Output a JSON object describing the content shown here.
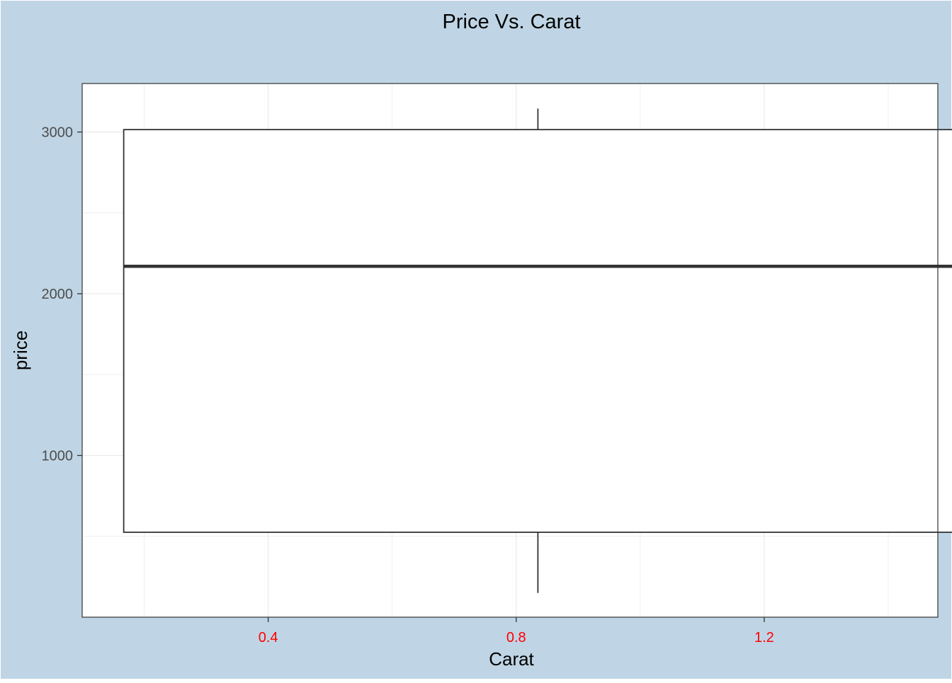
{
  "chart_data": {
    "type": "boxplot",
    "title": "Price Vs. Carat",
    "xlabel": "Carat",
    "ylabel": "price",
    "xlim": [
      0.1,
      1.48
    ],
    "ylim": [
      0,
      3300
    ],
    "x_ticks": [
      0.4,
      0.8,
      1.2
    ],
    "y_ticks": [
      1000,
      2000,
      3000
    ],
    "grid": true,
    "box": {
      "x_min": 0.167,
      "x_max": 1.505,
      "x_center": 0.835,
      "whisker_low": 150,
      "q1": 525,
      "median": 2170,
      "q3": 3015,
      "whisker_high": 3145
    },
    "colors": {
      "background": "#bfd5e5",
      "panel": "#ffffff",
      "x_tick_label": "#ff0000",
      "y_tick_label": "#4d4d4d",
      "box_stroke": "#333333",
      "grid": "#ebebeb"
    }
  }
}
